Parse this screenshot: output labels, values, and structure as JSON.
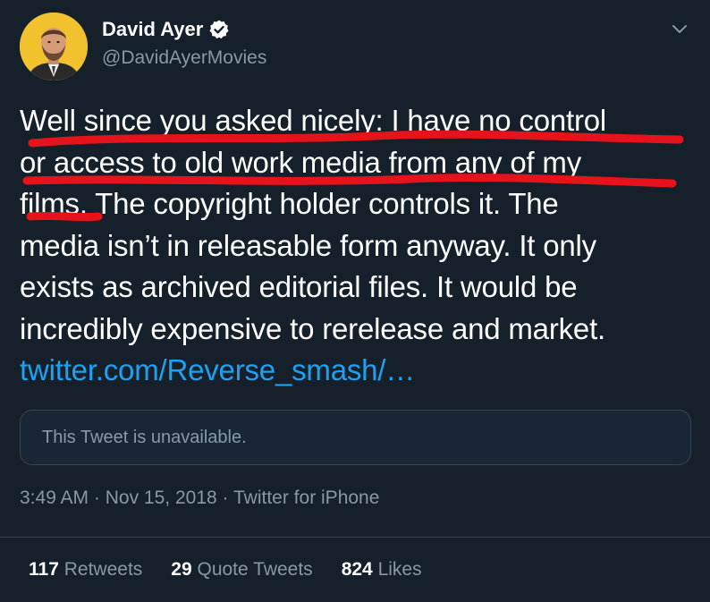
{
  "author": {
    "display_name": "David Ayer",
    "handle": "@DavidAyerMovies",
    "verified": true,
    "avatar_icon": "avatar-bearded-man",
    "avatar_bg": "#f2c12e"
  },
  "tweet": {
    "lines": [
      "Well since you asked nicely: I have no control",
      "or access to old work media from any of my",
      "films. The copyright holder controls it. The",
      "media isn’t in releasable form anyway. It only",
      "exists as archived editorial files. It would be",
      "incredibly expensive to rerelease and market."
    ],
    "link_text": "twitter.com/Reverse_smash/…"
  },
  "quote": {
    "text": "This Tweet is unavailable."
  },
  "meta": {
    "time": "3:49 AM",
    "date": "Nov 15, 2018",
    "source": "Twitter for iPhone",
    "separator": "·"
  },
  "stats": {
    "retweets_count": "117",
    "retweets_label": "Retweets",
    "quotes_count": "29",
    "quotes_label": "Quote Tweets",
    "likes_count": "824",
    "likes_label": "Likes"
  },
  "colors": {
    "background": "#15202b",
    "link": "#1da1f2",
    "muted": "#8899a6",
    "underline_mark": "#e5131b",
    "border": "#38444d"
  }
}
